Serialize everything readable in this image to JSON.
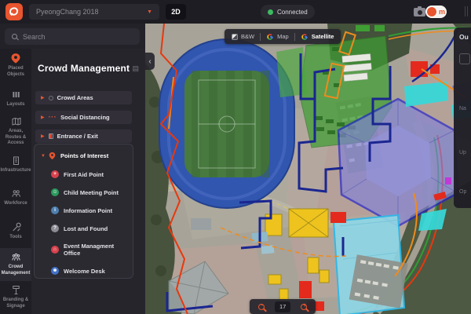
{
  "topbar": {
    "event_selector": {
      "value": "PyeongChang 2018"
    },
    "mode_button": "2D",
    "connection": {
      "label": "Connected",
      "dot_color": "#3dba61"
    },
    "avatar": {
      "initial": "m"
    },
    "accent_color": "#e8552e"
  },
  "search": {
    "placeholder": "Search"
  },
  "nav_rail": {
    "items": [
      {
        "label": "Placed Objects",
        "icon": "map-pin-icon"
      },
      {
        "label": "Layouts",
        "icon": "layouts-icon"
      },
      {
        "label": "Areas, Routes & Access",
        "icon": "areas-routes-icon"
      },
      {
        "label": "Infrastructure",
        "icon": "infrastructure-icon"
      },
      {
        "label": "Workforce",
        "icon": "workforce-icon"
      },
      {
        "label": "Tools",
        "icon": "tools-icon"
      },
      {
        "label": "Crowd Management",
        "icon": "crowd-icon",
        "selected": true
      },
      {
        "label": "Branding & Signage",
        "icon": "signage-icon"
      }
    ]
  },
  "panel": {
    "title": "Crowd Management",
    "sections": [
      {
        "label": "Crowd Areas",
        "icon": "circle-icon"
      },
      {
        "label": "Social Distancing",
        "icon": "dots-icon"
      },
      {
        "label": "Entrance / Exit",
        "icon": "gate-icon"
      }
    ],
    "poi": {
      "label": "Points of Interest",
      "items": [
        {
          "label": "First Aid Point",
          "icon": "first-aid-icon",
          "color": "#d8414d",
          "glyph": "+"
        },
        {
          "label": "Child Meeting Point",
          "icon": "child-meeting-icon",
          "color": "#2a9a5c",
          "glyph": "☺"
        },
        {
          "label": "Information Point",
          "icon": "information-icon",
          "color": "#4d7fae",
          "glyph": "i"
        },
        {
          "label": "Lost and Found",
          "icon": "lost-found-icon",
          "color": "#8d8c95",
          "glyph": "?"
        },
        {
          "label": "Event Managment Office",
          "icon": "event-office-icon",
          "color": "#d8414d",
          "glyph": "⌂"
        },
        {
          "label": "Welcome Desk",
          "icon": "welcome-desk-icon",
          "color": "#4272c8",
          "glyph": "☻"
        }
      ]
    }
  },
  "map": {
    "style_switcher": {
      "options": [
        {
          "label": "B&W"
        },
        {
          "label": "Map"
        },
        {
          "label": "Satellite"
        }
      ],
      "selected": "Satellite"
    },
    "zoom": {
      "level": "17"
    },
    "collapse_chevron": "‹",
    "right_panel": {
      "fragments": [
        "Ou",
        "Na",
        "Up",
        "Op"
      ]
    }
  }
}
